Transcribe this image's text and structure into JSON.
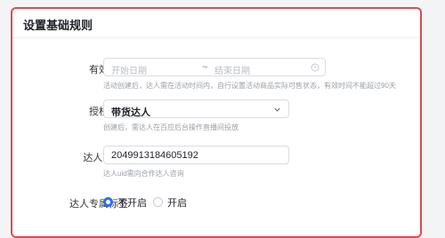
{
  "section_title": "设置基础规则",
  "validity": {
    "label": "有效时间",
    "start_placeholder": "开始日期",
    "end_placeholder": "结束日期",
    "separator": "~",
    "hint": "活动创建后，达人需在活动时间内，自行设置活动商品实际可售状态，有效时间不能超过90天"
  },
  "author": {
    "label": "授权作者",
    "value": "带货达人",
    "hint": "创建后，需达人在百应后台操作直播间投放"
  },
  "influencer_uid": {
    "label": "达人uid",
    "help": "?",
    "value": "2049913184605192",
    "hint": "达人uid需向合作达人咨询"
  },
  "exclusive_tag": {
    "label": "达人专属标签",
    "options": [
      "不开启",
      "开启"
    ],
    "selected": "不开启"
  },
  "colors": {
    "accent": "#2f6bff",
    "highlight_border": "#e5484d"
  },
  "icons": {
    "calendar": "calendar-icon",
    "dropdown": "chevron-down-icon",
    "help": "help-circle-icon"
  }
}
